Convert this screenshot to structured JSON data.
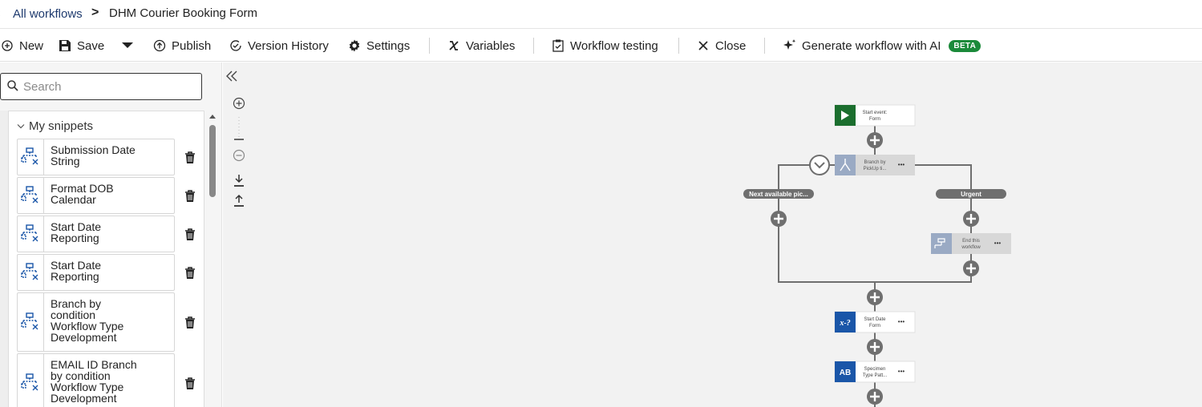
{
  "breadcrumb": {
    "root": "All workflows",
    "separator": ">",
    "current": "DHM Courier Booking Form"
  },
  "toolbar": {
    "new_label": "New",
    "save_label": "Save",
    "publish_label": "Publish",
    "version_history_label": "Version History",
    "settings_label": "Settings",
    "variables_label": "Variables",
    "workflow_testing_label": "Workflow testing",
    "close_label": "Close",
    "generate_label": "Generate workflow with AI",
    "beta_badge": "BETA"
  },
  "search": {
    "placeholder": "Search",
    "value": ""
  },
  "snippets": {
    "header": "My snippets",
    "items": [
      {
        "line1": "Submission Date",
        "line2": "String",
        "line3": "",
        "line4": ""
      },
      {
        "line1": "Format DOB",
        "line2": "Calendar",
        "line3": "",
        "line4": ""
      },
      {
        "line1": "Start Date",
        "line2": "Reporting",
        "line3": "",
        "line4": ""
      },
      {
        "line1": "Start Date",
        "line2": "Reporting",
        "line3": "",
        "line4": ""
      },
      {
        "line1": "Branch by",
        "line2": "condition",
        "line3": "Workflow Type",
        "line4": "Development"
      },
      {
        "line1": "EMAIL ID Branch",
        "line2": "by condition",
        "line3": "Workflow Type",
        "line4": "Development"
      }
    ]
  },
  "flow": {
    "start_line1": "Start event:",
    "start_line2": "Form",
    "branch_line1": "Branch by",
    "branch_line2": "PickUp ti...",
    "left_branch_label": "Next available pic...",
    "right_branch_label": "Urgent",
    "end_line1": "End this",
    "end_line2": "workflow",
    "var_line1": "Start Date",
    "var_line2": "Form",
    "var_icon_text": "x-?",
    "specimen_line1": "Specimen",
    "specimen_line2": "Type Patt...",
    "specimen_icon_text": "AB",
    "more_glyph": "•••"
  },
  "colors": {
    "start_green": "#1b6e2e",
    "brand_blue": "#1a56a8",
    "disabled_blue": "#9aaac4",
    "connector": "#6f6f6f",
    "beta_green": "#1b8a3a"
  }
}
